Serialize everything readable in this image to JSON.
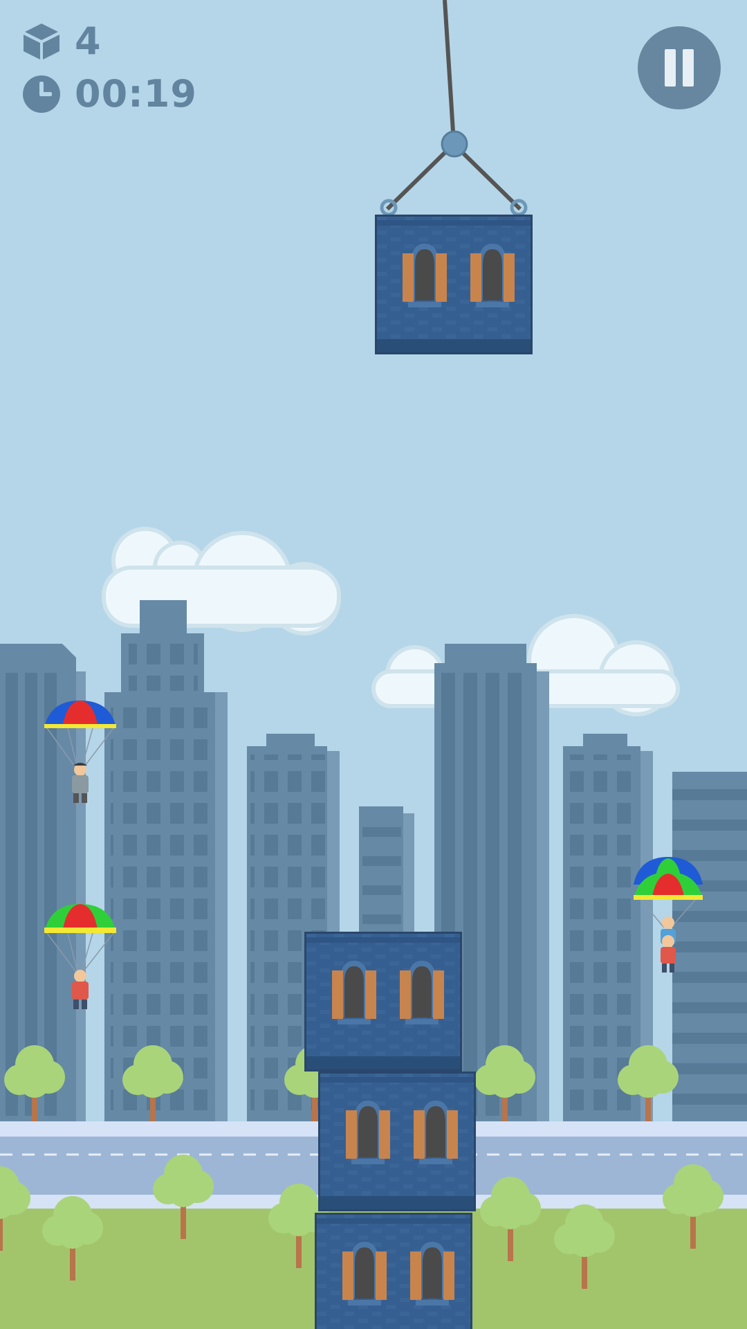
{
  "hud": {
    "blocks_icon": "cube-icon",
    "blocks_count": "4",
    "time_icon": "clock-icon",
    "time": "00:19",
    "pause_icon": "pause-icon"
  },
  "scene": {
    "colors": {
      "sky": "#b5d6e8",
      "building": "#6689a6",
      "building_window": "#567995",
      "road": "#9db6d5",
      "grass": "#a2c56c",
      "tree": "#a9d47a",
      "trunk": "#b8744a",
      "block": "#365f91",
      "shutter": "#c8844d"
    },
    "tower_blocks_on_ground": 3,
    "crane_block_count": 1,
    "parachutists": [
      {
        "canopy": [
          "blue",
          "red",
          "yellow"
        ]
      },
      {
        "canopy": [
          "yellow",
          "red",
          "green"
        ]
      },
      {
        "canopy": [
          "blue",
          "green",
          "red",
          "yellow"
        ]
      }
    ]
  }
}
